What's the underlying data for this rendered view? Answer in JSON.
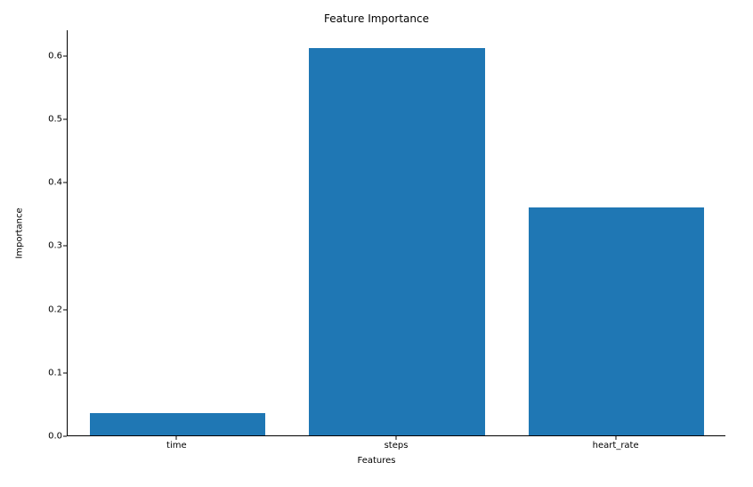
{
  "chart_data": {
    "type": "bar",
    "title": "Feature Importance",
    "xlabel": "Features",
    "ylabel": "Importance",
    "categories": [
      "time",
      "steps",
      "heart_rate"
    ],
    "values": [
      0.035,
      0.61,
      0.36
    ],
    "ylim": [
      0.0,
      0.64
    ],
    "yticks": [
      0.0,
      0.1,
      0.2,
      0.3,
      0.4,
      0.5,
      0.6
    ],
    "bar_color": "#1f77b4"
  }
}
